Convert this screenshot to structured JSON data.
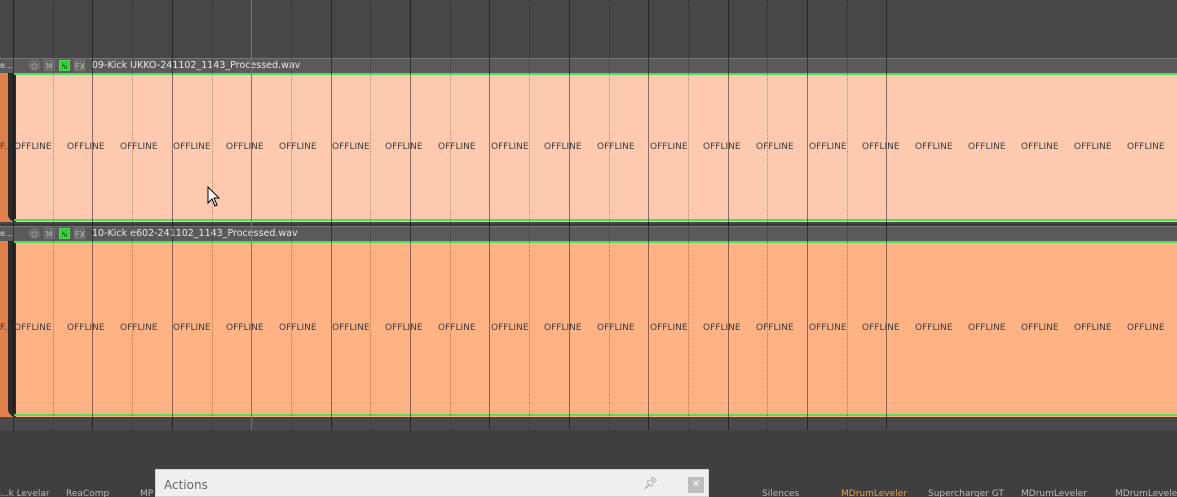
{
  "tracks": [
    {
      "filename": "09-Kick UKKO-241102_1143_Processed.wav",
      "prefix": "e...",
      "buttons": [
        "M",
        "FX"
      ],
      "color": "#fdcab0",
      "offline_first": "F...",
      "offline_labels": [
        "OFFLINE",
        "OFFLINE",
        "OFFLINE",
        "OFFLINE",
        "OFFLINE",
        "OFFLINE",
        "OFFLINE",
        "OFFLINE",
        "OFFLINE",
        "OFFLINE",
        "OFFLINE",
        "OFFLINE",
        "OFFLINE",
        "OFFLINE",
        "OFFLINE",
        "OFFLINE",
        "OFFLINE",
        "OFFLINE",
        "OFFLINE",
        "OFFLINE",
        "OFFLINE",
        "OFFLINE"
      ]
    },
    {
      "filename": "10-Kick e602-241102_1143_Processed.wav",
      "prefix": "e...",
      "buttons": [
        "M",
        "FX"
      ],
      "color": "#ffb283",
      "offline_first": "F...",
      "offline_labels": [
        "OFFLINE",
        "OFFLINE",
        "OFFLINE",
        "OFFLINE",
        "OFFLINE",
        "OFFLINE",
        "OFFLINE",
        "OFFLINE",
        "OFFLINE",
        "OFFLINE",
        "OFFLINE",
        "OFFLINE",
        "OFFLINE",
        "OFFLINE",
        "OFFLINE",
        "OFFLINE",
        "OFFLINE",
        "OFFLINE",
        "OFFLINE",
        "OFFLINE",
        "OFFLINE",
        "OFFLINE"
      ]
    }
  ],
  "actions_window": {
    "title": "Actions",
    "pin_icon": "pin-icon",
    "close_icon": "close-icon"
  },
  "bottom_tabs": [
    {
      "label": "...k Levelar",
      "active": false
    },
    {
      "label": "ReaComp",
      "active": false
    },
    {
      "label": "MP",
      "active": false
    },
    {
      "label": "Silences",
      "active": false
    },
    {
      "label": "MDrumLeveler",
      "active": true
    },
    {
      "label": "Supercharger GT",
      "active": false
    },
    {
      "label": "MDrumLeveler",
      "active": false
    },
    {
      "label": "MDrumLeveler",
      "active": false
    }
  ],
  "colors": {
    "accent_green": "#55dd55",
    "play_cursor": "#19a38f",
    "active_tab": "#e8a04a"
  }
}
